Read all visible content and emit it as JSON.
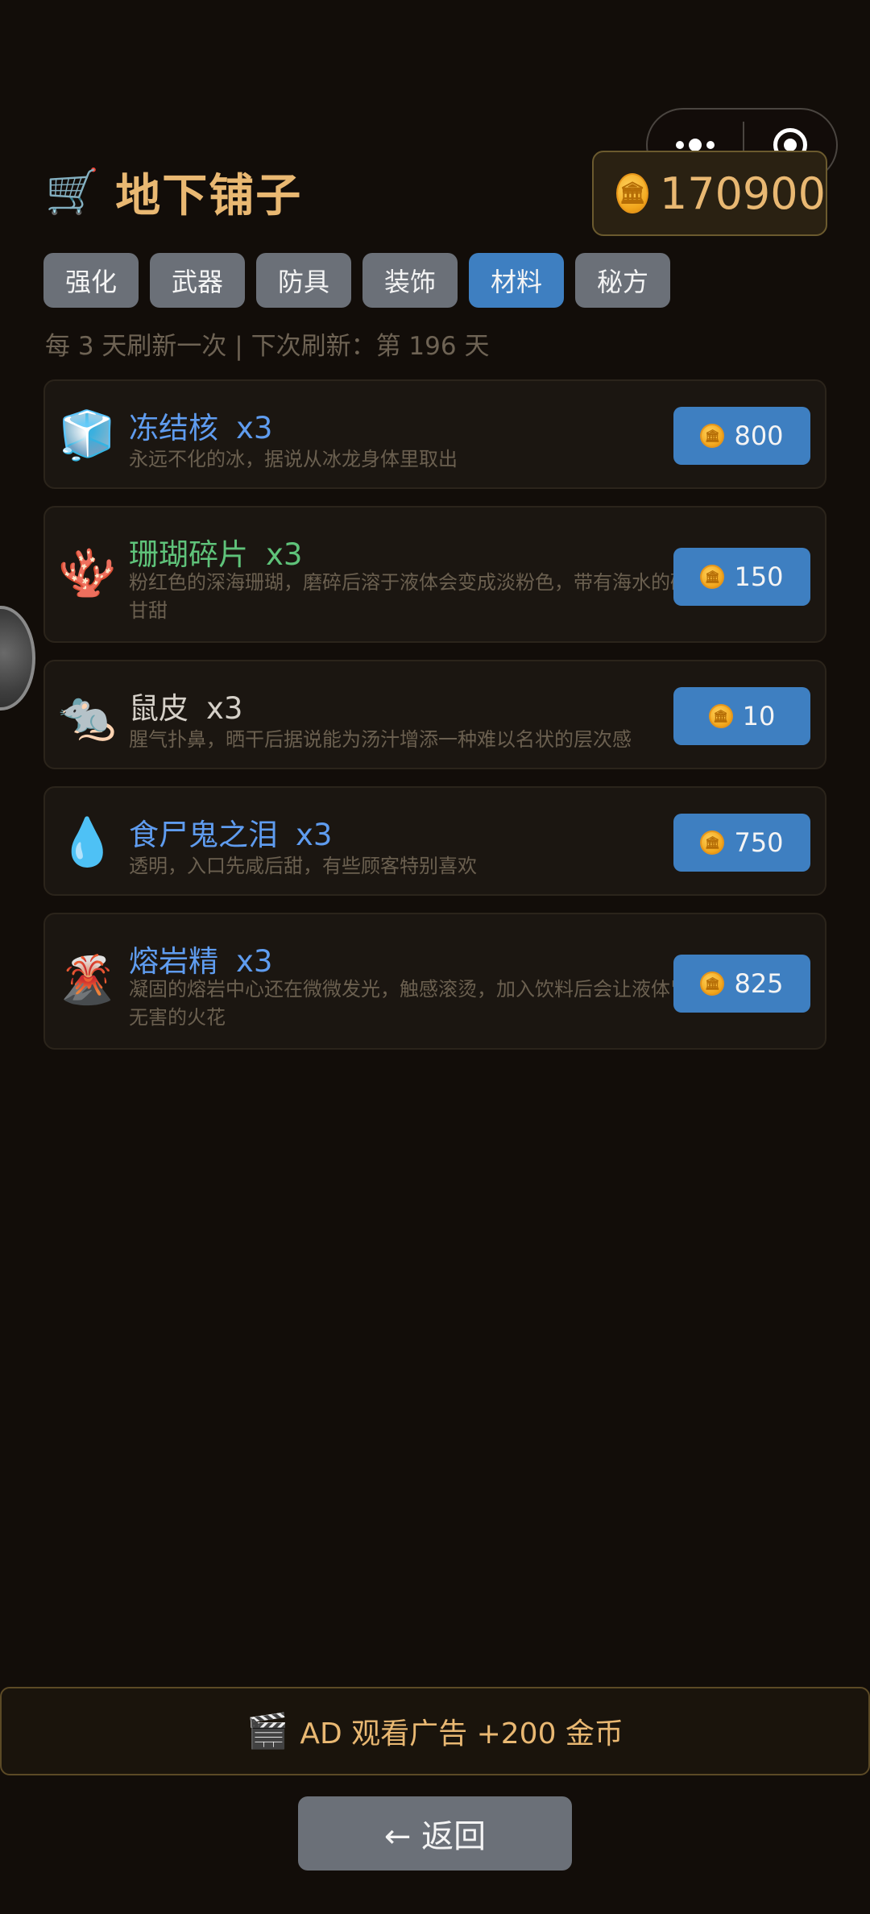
{
  "capsule": {
    "more_icon": "more-dots-icon",
    "close_icon": "close-target-icon"
  },
  "header": {
    "cart_icon": "🛒",
    "title": "地下铺子",
    "coins": "170900",
    "coin_glyph": "🏛"
  },
  "tabs": [
    {
      "label": "强化",
      "active": false
    },
    {
      "label": "武器",
      "active": false
    },
    {
      "label": "防具",
      "active": false
    },
    {
      "label": "装饰",
      "active": false
    },
    {
      "label": "材料",
      "active": true
    },
    {
      "label": "秘方",
      "active": false
    }
  ],
  "refresh_text": "每 3 天刷新一次 | 下次刷新：第 196 天",
  "items": [
    {
      "icon": "🧊",
      "name": "冻结核",
      "qty": "x3",
      "color": "#5f9cef",
      "desc": "永远不化的冰，据说从冰龙身体里取出",
      "price": "800"
    },
    {
      "icon": "🪸",
      "name": "珊瑚碎片",
      "qty": "x3",
      "color": "#5fc37a",
      "desc": "粉红色的深海珊瑚，磨碎后溶于液体会变成淡粉色，带有海水的矿物甘甜",
      "price": "150"
    },
    {
      "icon": "🐀",
      "name": "鼠皮",
      "qty": "x3",
      "color": "#d5d0c8",
      "desc": "腥气扑鼻，晒干后据说能为汤汁增添一种难以名状的层次感",
      "price": "10"
    },
    {
      "icon": "💧",
      "name": "食尸鬼之泪",
      "qty": "x3",
      "color": "#5f9cef",
      "desc": "透明，入口先咸后甜，有些顾客特别喜欢",
      "price": "750"
    },
    {
      "icon": "🌋",
      "name": "熔岩精",
      "qty": "x3",
      "color": "#5f9cef",
      "desc": "凝固的熔岩中心还在微微发光，触感滚烫，加入饮料后会让液体冒出无害的火花",
      "price": "825"
    }
  ],
  "ad": {
    "icon": "🎬",
    "text": "AD 观看广告 +200 金币"
  },
  "back_label": "← 返回"
}
